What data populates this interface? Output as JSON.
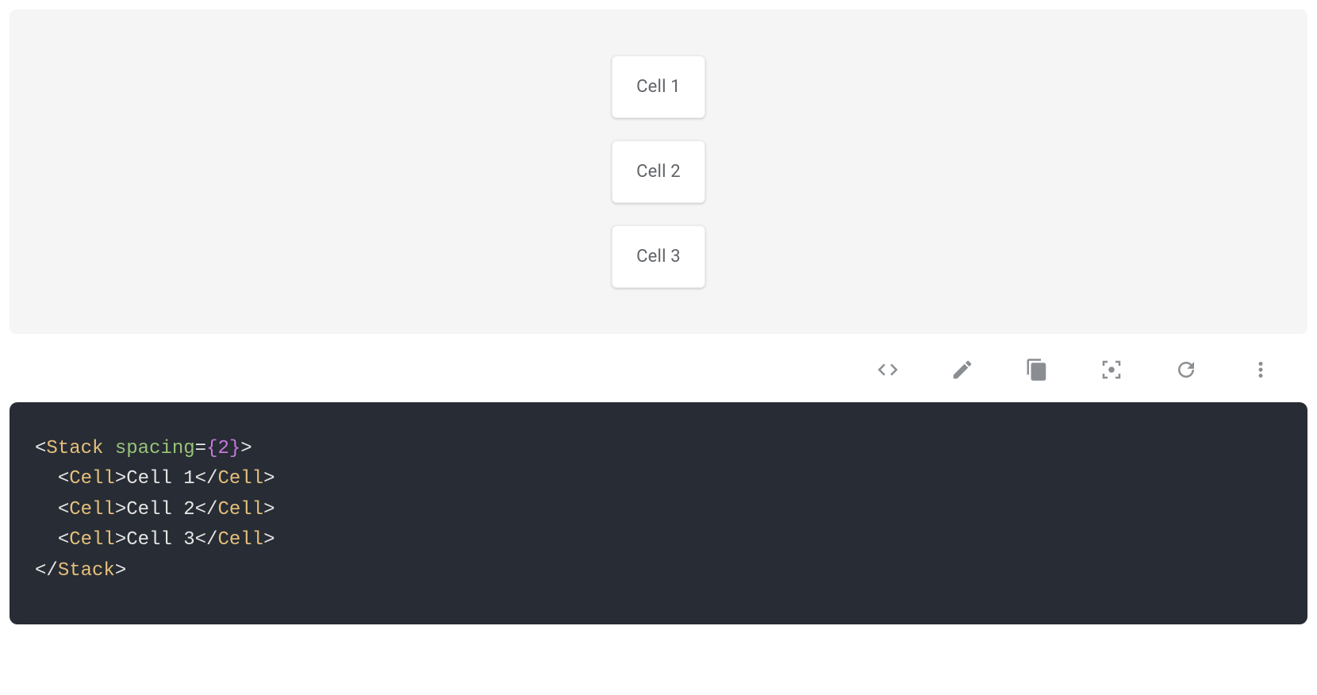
{
  "preview": {
    "cells": [
      "Cell 1",
      "Cell 2",
      "Cell 3"
    ]
  },
  "toolbar": {
    "icons": {
      "code": "code-icon",
      "edit": "pencil-icon",
      "copy": "copy-icon",
      "scan": "fullscreen-scan-icon",
      "refresh": "refresh-icon",
      "more": "more-vert-icon"
    }
  },
  "code": {
    "tag_stack": "Stack",
    "attr_spacing": "spacing",
    "spacing_value": "2",
    "tag_cell": "Cell",
    "cell_texts": [
      "Cell 1",
      "Cell 2",
      "Cell 3"
    ]
  }
}
